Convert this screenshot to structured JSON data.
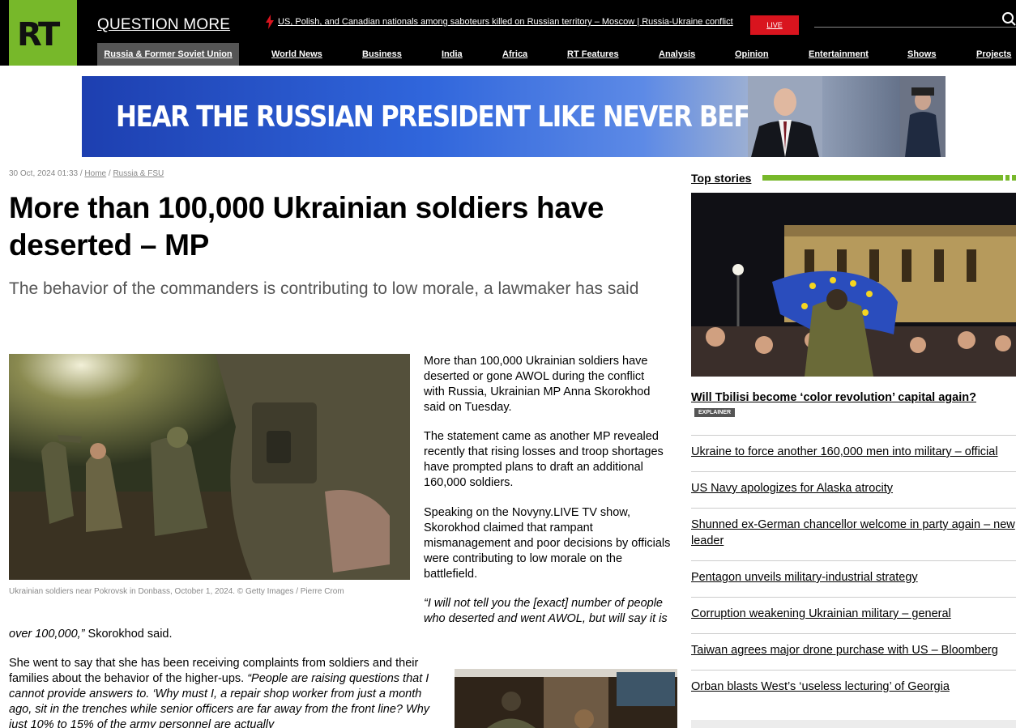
{
  "header": {
    "logo": "RT",
    "slogan": "QUESTION MORE",
    "breaking": "US, Polish, and Canadian nationals among saboteurs killed on Russian territory – Moscow | Russia-Ukraine conflict",
    "live_label": "LIVE",
    "nav_active": "Russia & Former Soviet Union",
    "nav": [
      "World News",
      "Business",
      "India",
      "Africa",
      "RT Features",
      "Analysis",
      "Opinion",
      "Entertainment",
      "Shows",
      "Projects"
    ]
  },
  "banner": {
    "text": "HEAR THE RUSSIAN PRESIDENT LIKE NEVER BEFORE"
  },
  "article": {
    "date": "30 Oct, 2024 01:33",
    "breadcrumb": [
      "Home",
      "Russia & FSU"
    ],
    "title": "More than 100,000 Ukrainian soldiers have deserted – MP",
    "subtitle": "The behavior of the commanders is contributing to low morale, a lawmaker has said",
    "caption": "Ukrainian soldiers near Pokrovsk in Donbass, October 1, 2024. © Getty Images / Pierre Crom",
    "p1": "More than 100,000 Ukrainian soldiers have deserted or gone AWOL during the conflict with Russia, Ukrainian MP Anna Skorokhod said on Tuesday.",
    "p2": "The statement came as another MP revealed recently that rising losses and troop shortages have prompted plans to draft an additional 160,000 soldiers.",
    "p3": "Speaking on the Novyny.LIVE TV show, Skorokhod claimed that rampant mismanagement and poor decisions by officials were contributing to low morale on the battlefield.",
    "q1": "“I will not tell you the [exact] number of people who deserted and went AWOL, but will say it is",
    "q1_end": "over 100,000,”",
    "q1_attr": " Skorokhod said.",
    "p5_start": "She went to say that she has been receiving complaints from soldiers and their families about the behavior of the higher-ups. ",
    "p5_quote": "“People are raising questions that I cannot provide answers to. ‘Why must I, a repair shop worker from just a month ago, sit in the trenches while senior officers are far away from the front line? Why just 10% to 15% of the army personnel are actually"
  },
  "sidebar": {
    "label": "Top stories",
    "lead": "Will Tbilisi become ‘color revolution’ capital again?",
    "badge": "EXPLAINER",
    "stories": [
      "Ukraine to force another 160,000 men into military – official",
      "US Navy apologizes for Alaska atrocity",
      "Shunned ex-German chancellor welcome in party again – new leader",
      "Pentagon unveils military-industrial strategy",
      "Corruption weakening Ukrainian military – general",
      "Taiwan agrees major drone purchase with US – Bloomberg",
      "Orban blasts West’s ‘useless lecturing’ of Georgia"
    ]
  },
  "colors": {
    "accent": "#77b82a",
    "live": "#d9141e",
    "header_bg": "#000000"
  }
}
